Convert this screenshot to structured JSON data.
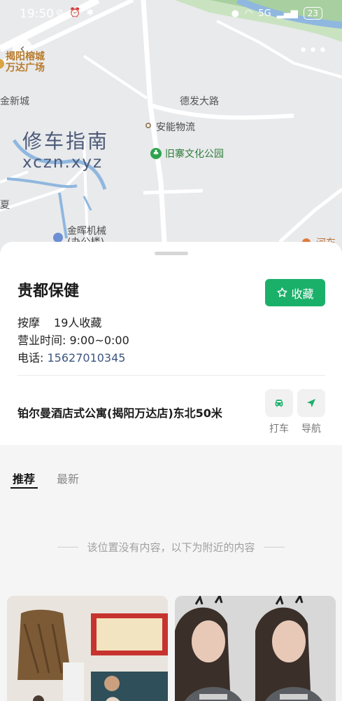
{
  "status_bar": {
    "time": "19:50",
    "left_icons": "⊘ ⏰ ✱",
    "network": "5G",
    "battery": "23"
  },
  "map": {
    "labels": {
      "mall": "揭阳榕城\n万达广场",
      "new_city": "金新城",
      "road": "德发大路",
      "logistics": "安能物流",
      "park": "旧寨文化公园",
      "machinery": "金晖机械",
      "office": "(办公楼)",
      "edge_left": "夏",
      "edge_right": "河东"
    },
    "watermark": {
      "cn": "修车指南",
      "en": "xczn.xyz"
    }
  },
  "place": {
    "name": "贵都保健",
    "favorite_label": "收藏",
    "category": "按摩",
    "favorites_count": "19人收藏",
    "hours": "营业时间: 9:00~0:00",
    "phone_label": "电话: ",
    "phone": "15627010345",
    "address": "铂尔曼酒店式公寓(揭阳万达店)东北50米",
    "actions": {
      "taxi": "打车",
      "navigate": "导航"
    }
  },
  "tabs": {
    "recommend": "推荐",
    "latest": "最新"
  },
  "notice": "该位置没有内容，以下为附近的内容",
  "colors": {
    "brand_green": "#1bb06a",
    "link_blue": "#3d5580"
  }
}
